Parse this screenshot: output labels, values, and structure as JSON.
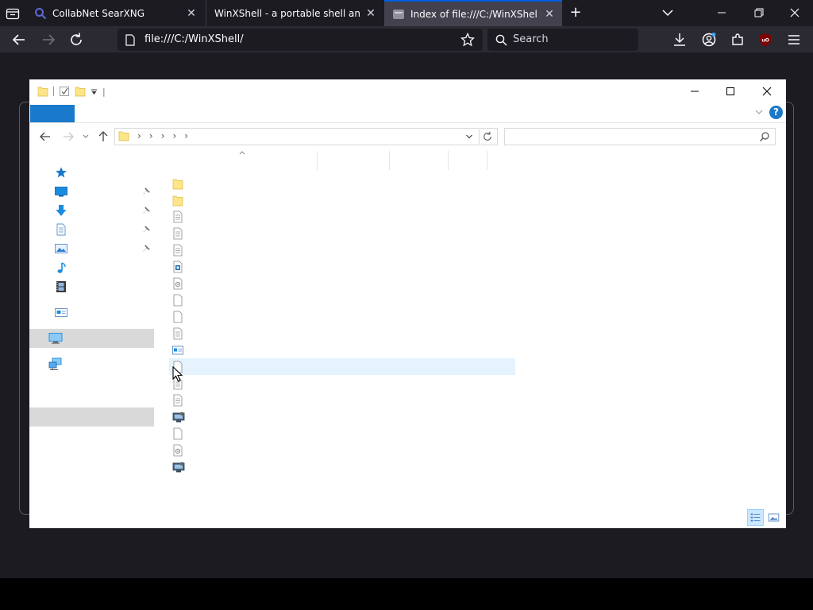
{
  "browser": {
    "tabs": [
      {
        "title": "CollabNet SearXNG",
        "active": false
      },
      {
        "title": "WinXShell - a portable shell and zero",
        "active": false
      },
      {
        "title": "Index of file:///C:/WinXShell/",
        "active": true
      }
    ],
    "url": "file:///C:/WinXShell/",
    "search_placeholder": "Search",
    "accent_color": "#0060df"
  },
  "explorer": {
    "quick_access": {
      "title_separator": "|"
    },
    "help_label": "?",
    "address_path": "",
    "breadcrumb_separators": [
      "›",
      "›",
      "›",
      "›",
      "›"
    ],
    "search_value": "",
    "nav_items": [
      {
        "icon": "quick-access-star-icon",
        "pinned": false
      },
      {
        "icon": "desktop-icon",
        "pinned": true
      },
      {
        "icon": "downloads-icon",
        "pinned": true
      },
      {
        "icon": "documents-icon",
        "pinned": true
      },
      {
        "icon": "pictures-icon",
        "pinned": true
      },
      {
        "icon": "music-icon",
        "pinned": false
      },
      {
        "icon": "videos-icon",
        "pinned": false
      },
      {
        "icon": "onedrive-icon",
        "pinned": false
      },
      {
        "icon": "this-pc-icon",
        "pinned": false,
        "selected": true
      },
      {
        "icon": "network-icon",
        "pinned": false
      }
    ],
    "files": [
      {
        "icon": "folder-icon"
      },
      {
        "icon": "folder-icon"
      },
      {
        "icon": "text-file-icon"
      },
      {
        "icon": "text-file-icon"
      },
      {
        "icon": "text-file-icon"
      },
      {
        "icon": "application-file-icon"
      },
      {
        "icon": "config-file-icon"
      },
      {
        "icon": "blank-file-icon"
      },
      {
        "icon": "blank-file-icon"
      },
      {
        "icon": "text-file-icon"
      },
      {
        "icon": "window-file-icon"
      },
      {
        "icon": "blank-file-icon",
        "hovered": true
      },
      {
        "icon": "text-file-icon"
      },
      {
        "icon": "text-file-icon"
      },
      {
        "icon": "executable-icon"
      },
      {
        "icon": "blank-file-icon"
      },
      {
        "icon": "config-file-icon"
      },
      {
        "icon": "executable-icon"
      }
    ],
    "view_modes": [
      "details-view-icon",
      "large-icons-view-icon"
    ],
    "active_view": "details-view-icon",
    "ribbon_file_tab_color": "#1979ca"
  }
}
